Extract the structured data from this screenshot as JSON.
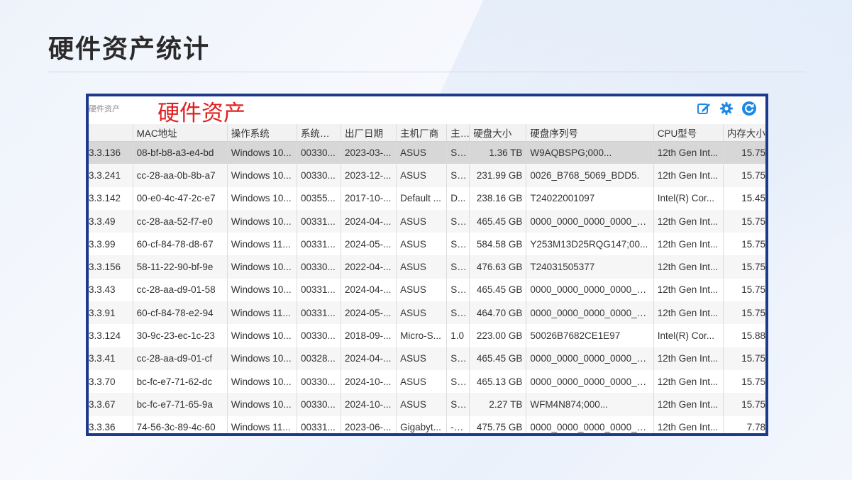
{
  "slide": {
    "title": "硬件资产统计"
  },
  "panel": {
    "caption": "硬件资产",
    "overlay_label": "硬件资产",
    "toolbar": {
      "edit_icon": "edit-icon",
      "settings_icon": "gear-icon",
      "refresh_icon": "refresh-icon",
      "accent_color": "#1e88e5"
    }
  },
  "table": {
    "headers": [
      "",
      "MAC地址",
      "操作系统",
      "系统产...",
      "出厂日期",
      "主机厂商",
      "主...",
      "硬盘大小",
      "硬盘序列号",
      "CPU型号",
      "内存大小"
    ],
    "rows": [
      [
        "3.3.136",
        "08-bf-b8-a3-e4-bd",
        "Windows 10...",
        "00330...",
        "2023-03-...",
        "ASUS",
        "Sy...",
        "1.36 TB",
        "W9AQBSPG;000...",
        "12th Gen Int...",
        "15.75"
      ],
      [
        "3.3.241",
        "cc-28-aa-0b-8b-a7",
        "Windows 10...",
        "00330...",
        "2023-12-...",
        "ASUS",
        "Sy...",
        "231.99 GB",
        "0026_B768_5069_BDD5.",
        "12th Gen Int...",
        "15.75"
      ],
      [
        "3.3.142",
        "00-e0-4c-47-2c-e7",
        "Windows 10...",
        "00355...",
        "2017-10-...",
        "Default ...",
        "D...",
        "238.16 GB",
        "T24022001097",
        "Intel(R) Cor...",
        "15.45"
      ],
      [
        "3.3.49",
        "cc-28-aa-52-f7-e0",
        "Windows 10...",
        "00331...",
        "2024-04-...",
        "ASUS",
        "Sy...",
        "465.45 GB",
        "0000_0000_0000_0000_0...",
        "12th Gen Int...",
        "15.75"
      ],
      [
        "3.3.99",
        "60-cf-84-78-d8-67",
        "Windows 11...",
        "00331...",
        "2024-05-...",
        "ASUS",
        "Sy...",
        "584.58 GB",
        "Y253M13D25RQG147;00...",
        "12th Gen Int...",
        "15.75"
      ],
      [
        "3.3.156",
        "58-11-22-90-bf-9e",
        "Windows 10...",
        "00330...",
        "2022-04-...",
        "ASUS",
        "Sy...",
        "476.63 GB",
        "T24031505377",
        "12th Gen Int...",
        "15.75"
      ],
      [
        "3.3.43",
        "cc-28-aa-d9-01-58",
        "Windows 10...",
        "00331...",
        "2024-04-...",
        "ASUS",
        "Sy...",
        "465.45 GB",
        "0000_0000_0000_0000_0...",
        "12th Gen Int...",
        "15.75"
      ],
      [
        "3.3.91",
        "60-cf-84-78-e2-94",
        "Windows 11...",
        "00331...",
        "2024-05-...",
        "ASUS",
        "Sy...",
        "464.70 GB",
        "0000_0000_0000_0000_0...",
        "12th Gen Int...",
        "15.75"
      ],
      [
        "3.3.124",
        "30-9c-23-ec-1c-23",
        "Windows 10...",
        "00330...",
        "2018-09-...",
        "Micro-S...",
        "1.0",
        "223.00 GB",
        "50026B7682CE1E97",
        "Intel(R) Cor...",
        "15.88"
      ],
      [
        "3.3.41",
        "cc-28-aa-d9-01-cf",
        "Windows 10...",
        "00328...",
        "2024-04-...",
        "ASUS",
        "Sy...",
        "465.45 GB",
        "0000_0000_0000_0000_0...",
        "12th Gen Int...",
        "15.75"
      ],
      [
        "3.3.70",
        "bc-fc-e7-71-62-dc",
        "Windows 10...",
        "00330...",
        "2024-10-...",
        "ASUS",
        "Sy...",
        "465.13 GB",
        "0000_0000_0000_0000_0...",
        "12th Gen Int...",
        "15.75"
      ],
      [
        "3.3.67",
        "bc-fc-e7-71-65-9a",
        "Windows 10...",
        "00330...",
        "2024-10-...",
        "ASUS",
        "Sy...",
        "2.27 TB",
        "WFM4N874;000...",
        "12th Gen Int...",
        "15.75"
      ],
      [
        "3.3.36",
        "74-56-3c-89-4c-60",
        "Windows 11...",
        "00331...",
        "2023-06-...",
        "Gigabyt...",
        "-CF",
        "475.75 GB",
        "0000_0000_0000_0000_0...",
        "12th Gen Int...",
        "7.78"
      ]
    ]
  }
}
